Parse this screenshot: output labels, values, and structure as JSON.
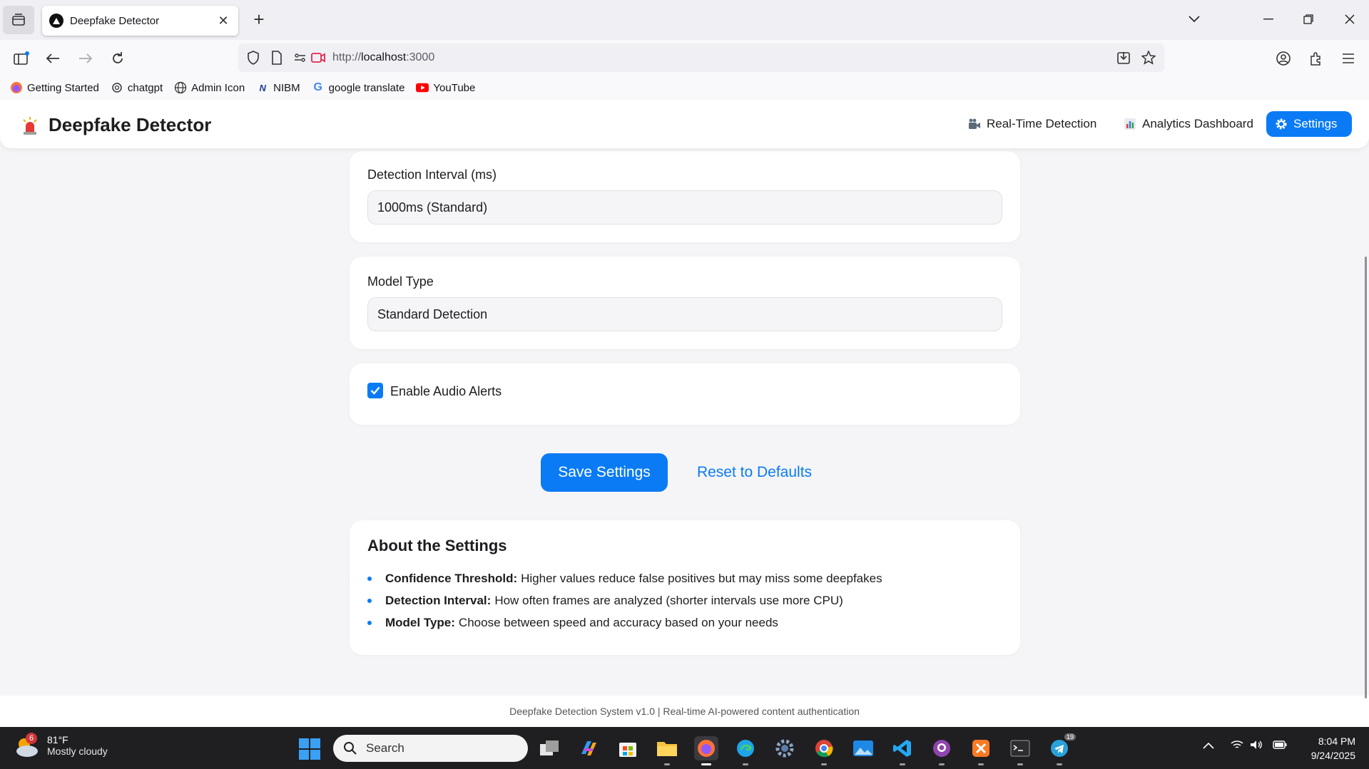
{
  "browser": {
    "tab_title": "Deepfake Detector",
    "url_prefix": "http://",
    "url_host": "localhost",
    "url_port": ":3000",
    "bookmarks": [
      {
        "label": "Getting Started",
        "icon": "firefox-icon"
      },
      {
        "label": "chatgpt",
        "icon": "chatgpt-icon"
      },
      {
        "label": "Admin Icon",
        "icon": "globe-icon"
      },
      {
        "label": "NIBM",
        "icon": "nibm-icon"
      },
      {
        "label": "google translate",
        "icon": "google-icon"
      },
      {
        "label": "YouTube",
        "icon": "youtube-icon"
      }
    ]
  },
  "app": {
    "brand": "Deepfake Detector",
    "nav": [
      {
        "label": "Real-Time Detection",
        "icon": "camera-icon",
        "active": false
      },
      {
        "label": "Analytics Dashboard",
        "icon": "bar-chart-icon",
        "active": false
      },
      {
        "label": "Settings",
        "icon": "gear-icon",
        "active": true
      }
    ]
  },
  "settings": {
    "interval_label": "Detection Interval (ms)",
    "interval_value": "1000ms (Standard)",
    "model_label": "Model Type",
    "model_value": "Standard Detection",
    "audio_label": "Enable Audio Alerts",
    "audio_checked": true,
    "save_label": "Save Settings",
    "reset_label": "Reset to Defaults"
  },
  "about": {
    "title": "About the Settings",
    "items": [
      {
        "term": "Confidence Threshold:",
        "text": "Higher values reduce false positives but may miss some deepfakes"
      },
      {
        "term": "Detection Interval:",
        "text": "How often frames are analyzed (shorter intervals use more CPU)"
      },
      {
        "term": "Model Type:",
        "text": "Choose between speed and accuracy based on your needs"
      }
    ]
  },
  "footer": "Deepfake Detection System v1.0 | Real-time AI-powered content authentication",
  "taskbar": {
    "weather_temp": "81°F",
    "weather_desc": "Mostly cloudy",
    "weather_badge": "6",
    "search_placeholder": "Search",
    "time": "8:04 PM",
    "date": "9/24/2025",
    "telegram_badge": "19"
  },
  "colors": {
    "accent": "#0a7bf5",
    "page_bg": "#f5f5f7",
    "taskbar_bg": "#1f1f22"
  }
}
